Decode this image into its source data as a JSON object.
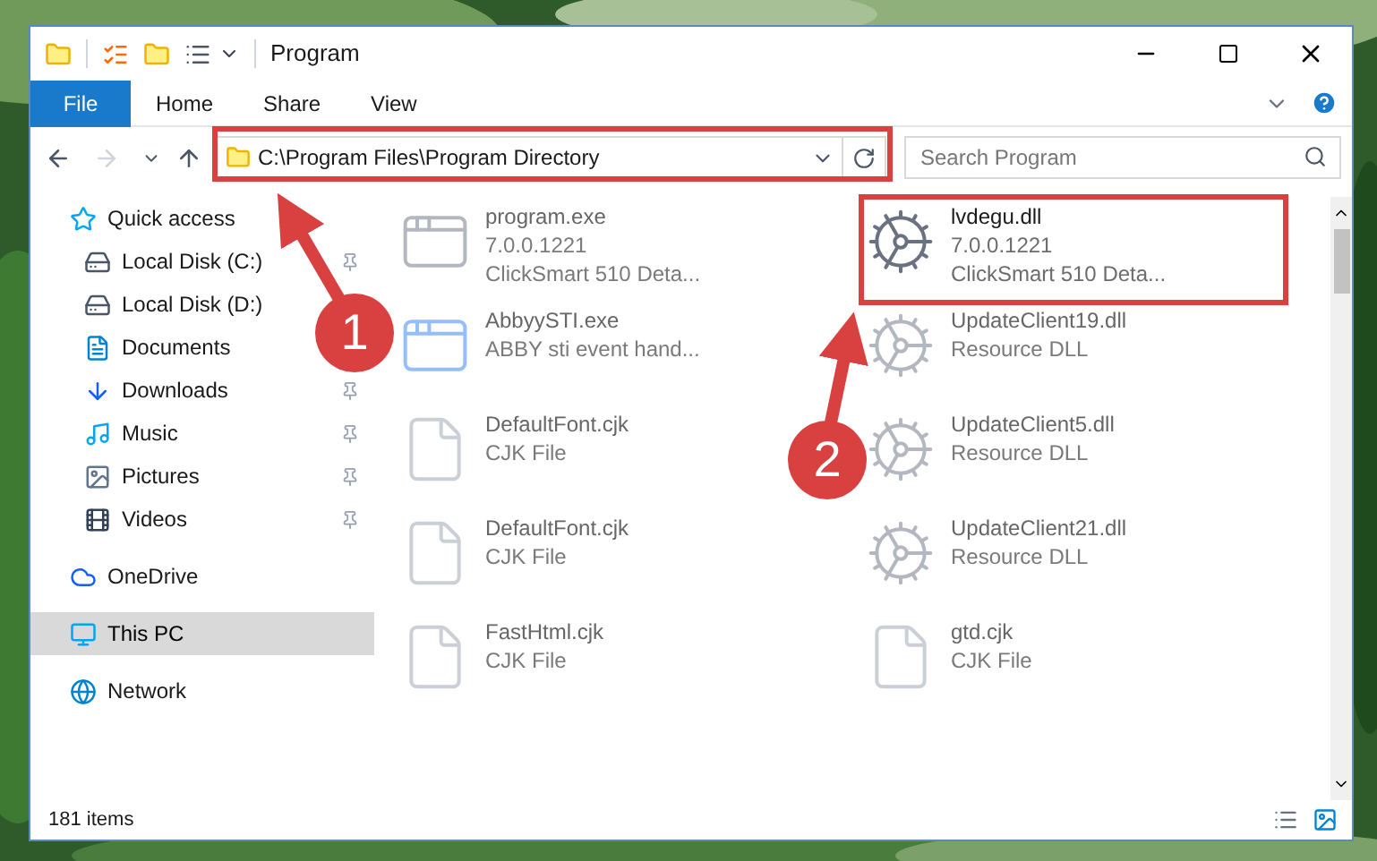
{
  "window": {
    "title": "Program"
  },
  "file_button": "File",
  "ribbon_tabs": [
    {
      "label": "Home",
      "selected": false
    },
    {
      "label": "Share",
      "selected": false
    },
    {
      "label": "View",
      "selected": false
    }
  ],
  "address": "C:\\Program Files\\Program Directory",
  "search": {
    "placeholder": "Search Program"
  },
  "sidebar": {
    "items": [
      {
        "label": "Quick access",
        "kind": "star",
        "selected": false,
        "children": [
          {
            "label": "Local Disk (C:)",
            "kind": "drive",
            "pinned": true,
            "selected": false
          },
          {
            "label": "Local Disk (D:)",
            "kind": "drive",
            "selected": false
          },
          {
            "label": "Documents",
            "kind": "documents",
            "selected": false
          },
          {
            "label": "Downloads",
            "kind": "downloads",
            "pinned": true,
            "selected": false
          },
          {
            "label": "Music",
            "kind": "music",
            "pinned": true,
            "selected": false
          },
          {
            "label": "Pictures",
            "kind": "pictures",
            "pinned": true,
            "selected": false
          },
          {
            "label": "Videos",
            "kind": "videos",
            "pinned": true,
            "selected": false
          }
        ]
      },
      {
        "label": "OneDrive",
        "kind": "cloud",
        "selected": false
      },
      {
        "label": "This PC",
        "kind": "computer",
        "selected": true
      },
      {
        "label": "Network",
        "kind": "network",
        "selected": false
      }
    ]
  },
  "files": [
    {
      "name": "program.exe",
      "lines": [
        "7.0.0.1221",
        "ClickSmart 510 Deta..."
      ],
      "kind": "exe",
      "faded": true
    },
    {
      "name": "lvdegu.dll",
      "lines": [
        "7.0.0.1221",
        "ClickSmart 510 Deta..."
      ],
      "kind": "dll",
      "faded": false
    },
    {
      "name": "AbbyySTI.exe",
      "lines": [
        "ABBY sti event hand..."
      ],
      "kind": "app",
      "faded": true
    },
    {
      "name": "UpdateClient19.dll",
      "lines": [
        "Resource DLL"
      ],
      "kind": "dll",
      "faded": true
    },
    {
      "name": "DefaultFont.cjk",
      "lines": [
        "CJK File"
      ],
      "kind": "cjk",
      "faded": true
    },
    {
      "name": "UpdateClient5.dll",
      "lines": [
        "Resource DLL"
      ],
      "kind": "dll",
      "faded": true
    },
    {
      "name": "DefaultFont.cjk",
      "lines": [
        "CJK File"
      ],
      "kind": "cjk",
      "faded": true
    },
    {
      "name": "UpdateClient21.dll",
      "lines": [
        "Resource DLL"
      ],
      "kind": "dll",
      "faded": true
    },
    {
      "name": "FastHtml.cjk",
      "lines": [
        "CJK File"
      ],
      "kind": "cjk",
      "faded": true
    },
    {
      "name": "gtd.cjk",
      "lines": [
        "CJK File"
      ],
      "kind": "cjk",
      "faded": true
    }
  ],
  "status_bar": {
    "count": "181 items"
  },
  "annotations": [
    {
      "label": "1"
    },
    {
      "label": "2"
    }
  ]
}
